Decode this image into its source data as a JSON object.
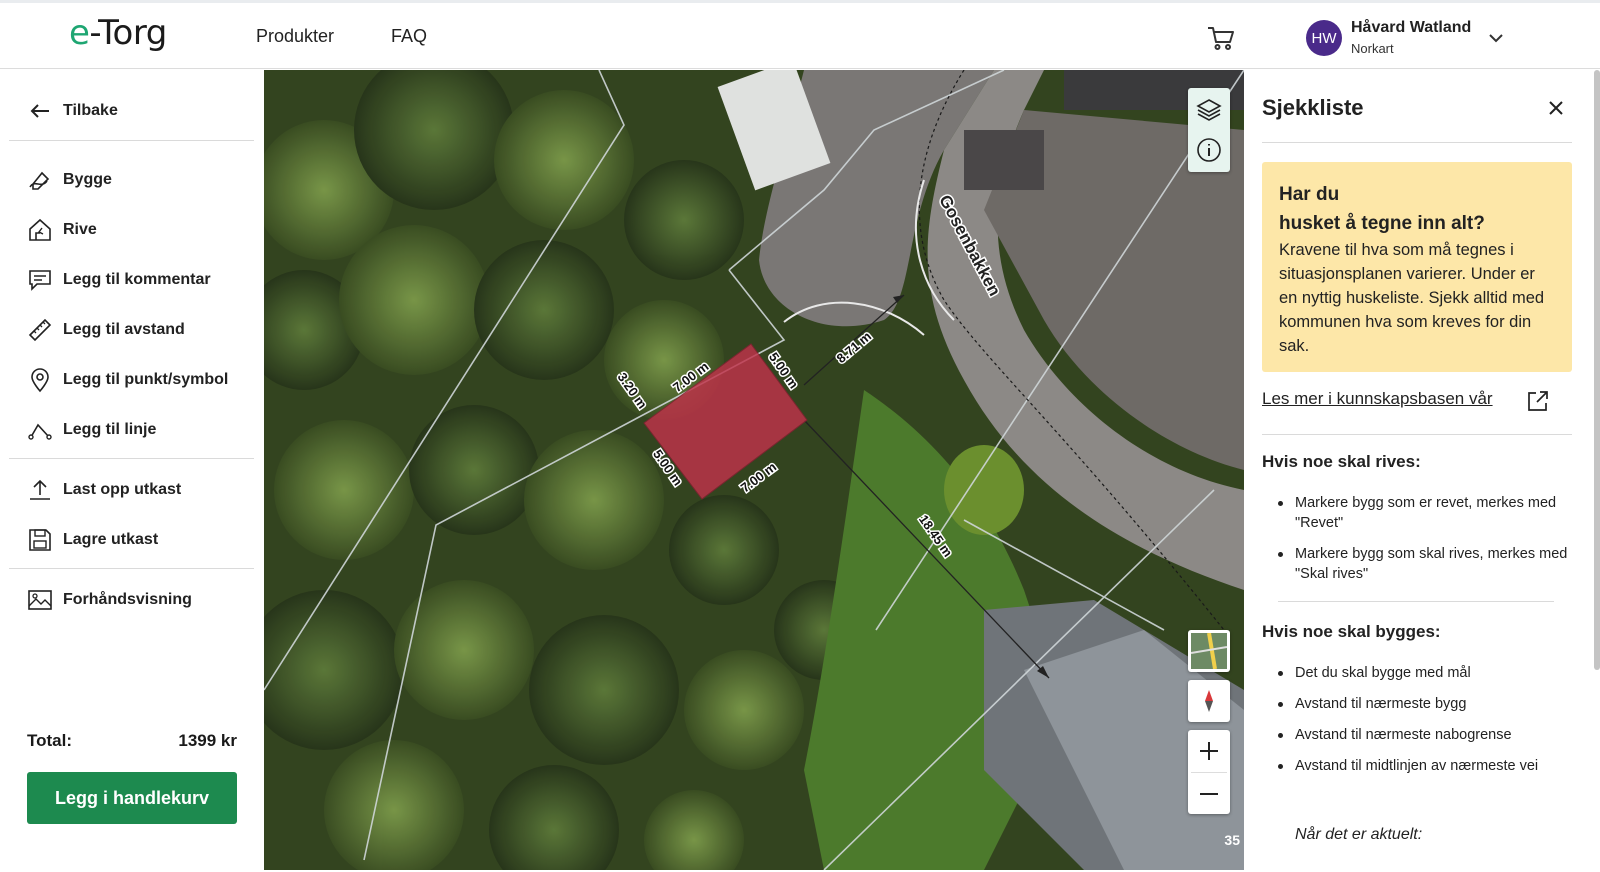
{
  "header": {
    "logo_e": "e",
    "logo_rest": "-Torg",
    "nav": [
      "Produkter",
      "FAQ"
    ],
    "user_initials": "HW",
    "user_name": "Håvard Watland",
    "user_org": "Norkart"
  },
  "sidebar": {
    "back": "Tilbake",
    "tools": [
      "Bygge",
      "Rive",
      "Legg til kommentar",
      "Legg til avstand",
      "Legg til punkt/symbol",
      "Legg til linje"
    ],
    "draft": [
      "Last opp utkast",
      "Lagre utkast"
    ],
    "preview": "Forhåndsvisning",
    "total_label": "Total:",
    "total_value": "1399 kr",
    "cart_button": "Legg i handlekurv"
  },
  "map": {
    "road_name": "Gosenbakken",
    "measurements": [
      "7.00 m",
      "5.00 m",
      "3.20 m",
      "5.00 m",
      "7.00 m",
      "8.71 m",
      "18.45 m"
    ],
    "scale_label": "35",
    "building_color": "#c0324a"
  },
  "panel": {
    "title": "Sjekkliste",
    "notice_title_1": "Har du",
    "notice_title_2": "husket å tegne inn alt?",
    "notice_body": "Kravene til hva som må tegnes i situasjonsplanen varierer. Under er en nyttig huskeliste. Sjekk alltid med kommunen hva som kreves for din sak.",
    "kb_link": "Les mer i kunnskapsbasen vår",
    "demolish_heading": "Hvis noe skal rives:",
    "demolish_items": [
      "Markere bygg som er revet, merkes med \"Revet\"",
      "Markere bygg som skal rives, merkes med \"Skal rives\""
    ],
    "build_heading": "Hvis noe skal bygges:",
    "build_items": [
      "Det du skal bygge med mål",
      "Avstand til nærmeste bygg",
      "Avstand til nærmeste nabogrense",
      "Avstand til midtlinjen av nærmeste vei"
    ],
    "note": "Når det er aktuelt:"
  }
}
